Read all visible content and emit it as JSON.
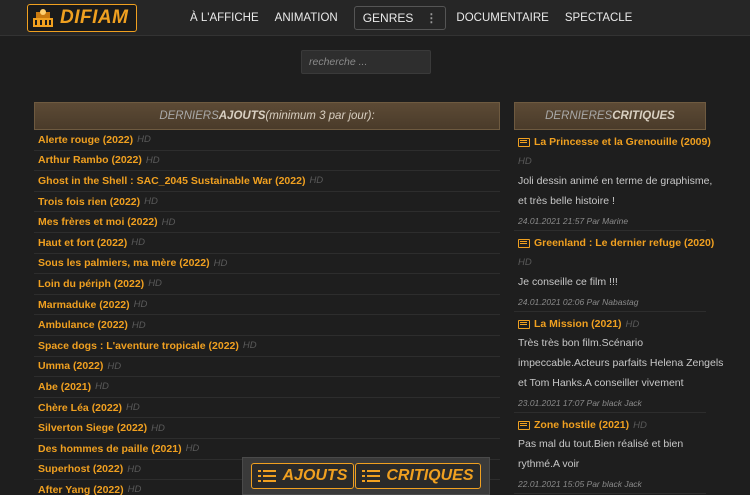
{
  "header": {
    "logo_text": "DIFIAM",
    "nav": [
      "À L'AFFICHE",
      "ANIMATION"
    ],
    "genres_label": "GENRES",
    "nav_after": [
      "DOCUMENTAIRE",
      "SPECTACLE"
    ]
  },
  "search": {
    "placeholder": "recherche ..."
  },
  "latest": {
    "heading_prefix": "DERNIERS ",
    "heading_bold": "AJOUTS",
    "heading_suffix": " (minimum 3 par jour):",
    "items": [
      {
        "title": "Alerte rouge (2022)",
        "badge": "HD"
      },
      {
        "title": "Arthur Rambo (2022)",
        "badge": "HD"
      },
      {
        "title": "Ghost in the Shell : SAC_2045 Sustainable War (2022)",
        "badge": "HD"
      },
      {
        "title": "Trois fois rien (2022)",
        "badge": "HD"
      },
      {
        "title": "Mes frères et moi (2022)",
        "badge": "HD"
      },
      {
        "title": "Haut et fort (2022)",
        "badge": "HD"
      },
      {
        "title": "Sous les palmiers, ma mère (2022)",
        "badge": "HD"
      },
      {
        "title": "Loin du périph (2022)",
        "badge": "HD"
      },
      {
        "title": "Marmaduke (2022)",
        "badge": "HD"
      },
      {
        "title": "Ambulance (2022)",
        "badge": "HD"
      },
      {
        "title": "Space dogs : L'aventure tropicale (2022)",
        "badge": "HD"
      },
      {
        "title": "Umma (2022)",
        "badge": "HD"
      },
      {
        "title": "Abe (2021)",
        "badge": "HD"
      },
      {
        "title": "Chère Léa (2022)",
        "badge": "HD"
      },
      {
        "title": "Silverton Siege (2022)",
        "badge": "HD"
      },
      {
        "title": "Des hommes de paille (2021)",
        "badge": "HD"
      },
      {
        "title": "Superhost (2022)",
        "badge": "HD"
      },
      {
        "title": "After Yang (2022)",
        "badge": "HD"
      }
    ]
  },
  "critiques": {
    "heading_prefix": "DERNIERES ",
    "heading_bold": "CRITIQUES",
    "items": [
      {
        "title": "La Princesse et la Grenouille (2009)",
        "title_badge": "",
        "hd_line": "HD",
        "lines": [
          "Joli dessin animé en terme de graphisme,",
          "et très belle histoire !"
        ],
        "meta": "24.01.2021 21:57 Par Marine"
      },
      {
        "title": "Greenland : Le dernier refuge (2020)",
        "title_badge": "",
        "hd_line": "HD",
        "lines": [
          "Je conseille ce film !!!"
        ],
        "meta": "24.01.2021 02:06 Par Nabastag"
      },
      {
        "title": "La Mission (2021)",
        "title_badge": "HD",
        "hd_line": "",
        "lines": [
          "Très très bon film.Scénario",
          "impeccable.Acteurs parfaits Helena Zengels",
          "et Tom Hanks.A conseiller vivement"
        ],
        "meta": "23.01.2021 17:07 Par black Jack"
      },
      {
        "title": "Zone hostile (2021)",
        "title_badge": "HD",
        "hd_line": "",
        "lines": [
          "Pas mal du tout.Bien réalisé et bien",
          "rythmé.A voir"
        ],
        "meta": "22.01.2021 15:05 Par black Jack"
      }
    ]
  },
  "bottom_bar": {
    "ajouts_label": "AJOUTS",
    "critiques_label": "CRITIQUES"
  },
  "colors": {
    "accent": "#f0a020",
    "background": "#1e1e1e",
    "panel_header": "#5c4a35"
  }
}
